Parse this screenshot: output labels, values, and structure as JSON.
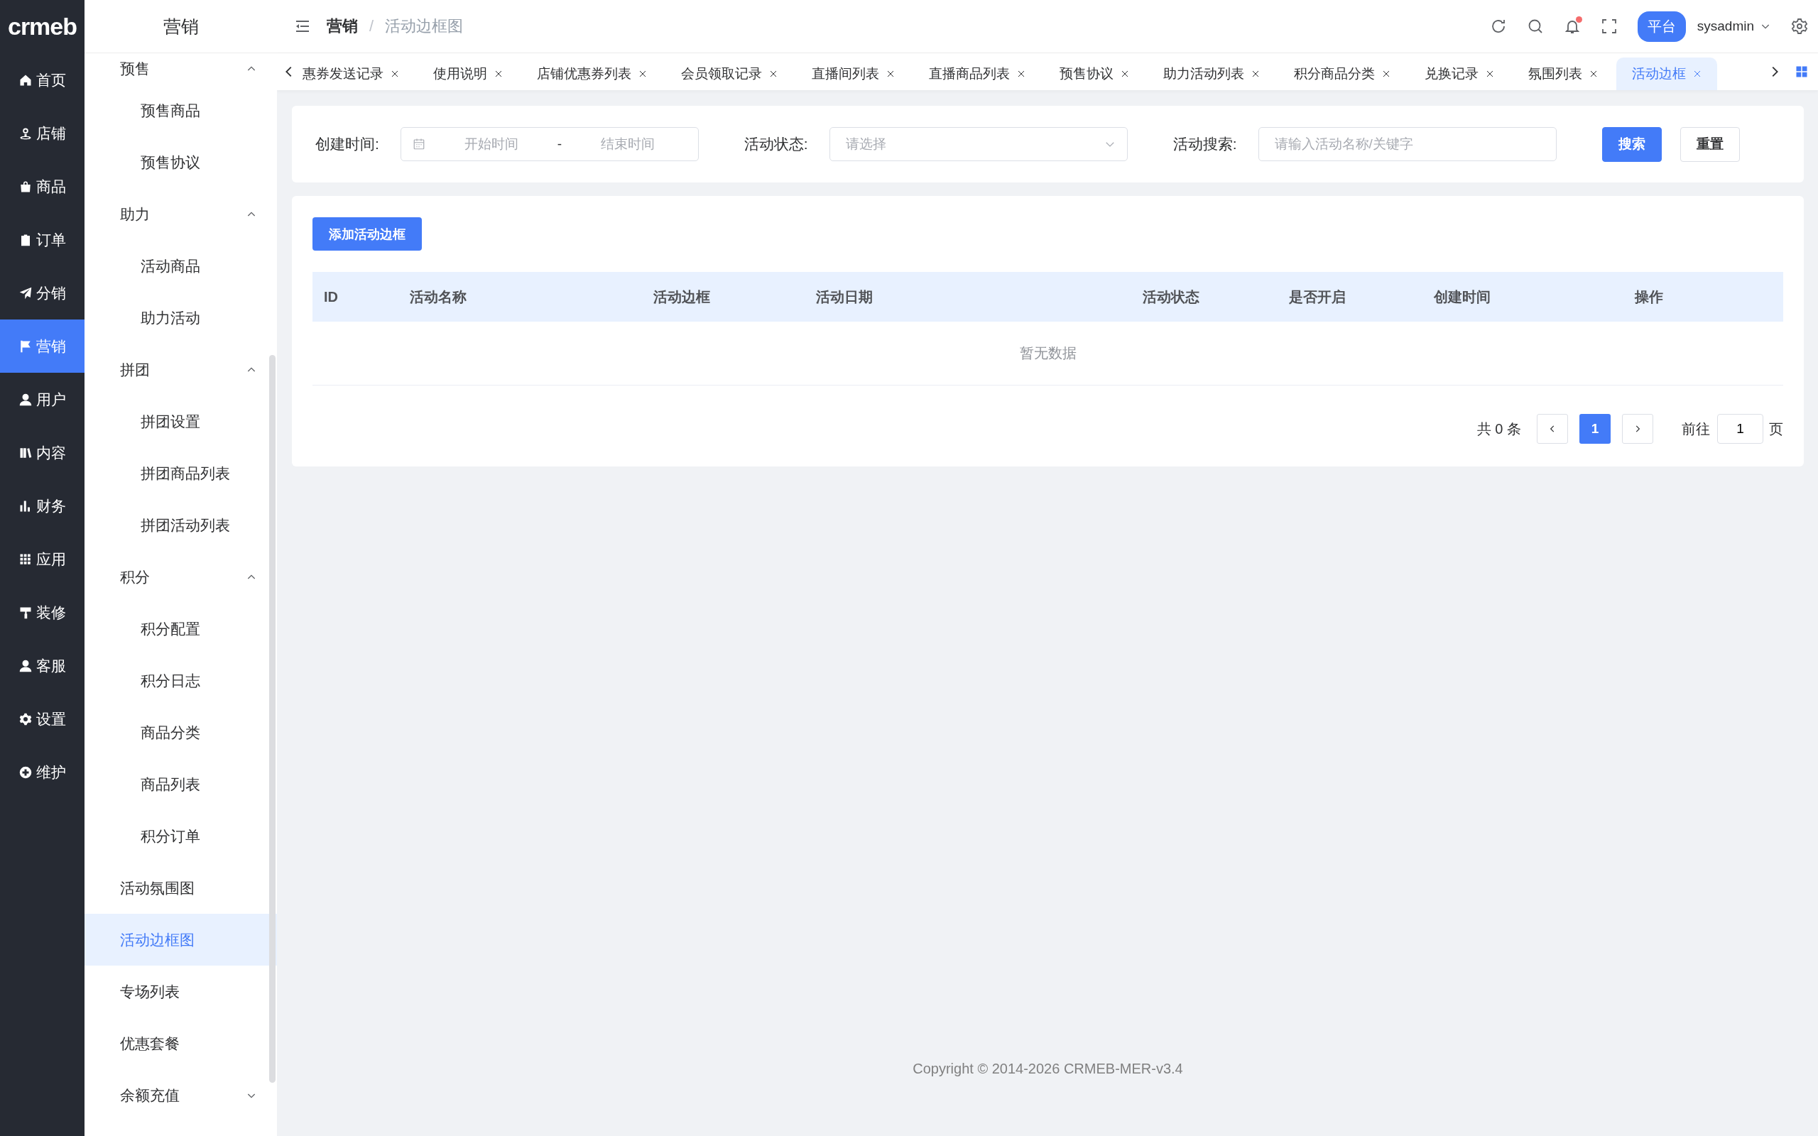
{
  "rail": {
    "logo": "crmeb",
    "items": [
      {
        "label": "首页",
        "selected": false
      },
      {
        "label": "店铺",
        "selected": false
      },
      {
        "label": "商品",
        "selected": false
      },
      {
        "label": "订单",
        "selected": false
      },
      {
        "label": "分销",
        "selected": false
      },
      {
        "label": "营销",
        "selected": true
      },
      {
        "label": "用户",
        "selected": false
      },
      {
        "label": "内容",
        "selected": false
      },
      {
        "label": "财务",
        "selected": false
      },
      {
        "label": "应用",
        "selected": false
      },
      {
        "label": "装修",
        "selected": false
      },
      {
        "label": "客服",
        "selected": false
      },
      {
        "label": "设置",
        "selected": false
      },
      {
        "label": "维护",
        "selected": false
      }
    ]
  },
  "sidebar": {
    "title": "营销",
    "items": [
      {
        "kind": "group",
        "label": "预售",
        "expanded": true,
        "children": [
          {
            "label": "预售商品",
            "selected": false
          },
          {
            "label": "预售协议",
            "selected": false
          }
        ]
      },
      {
        "kind": "group",
        "label": "助力",
        "expanded": true,
        "children": [
          {
            "label": "活动商品",
            "selected": false
          },
          {
            "label": "助力活动",
            "selected": false
          }
        ]
      },
      {
        "kind": "group",
        "label": "拼团",
        "expanded": true,
        "children": [
          {
            "label": "拼团设置",
            "selected": false
          },
          {
            "label": "拼团商品列表",
            "selected": false
          },
          {
            "label": "拼团活动列表",
            "selected": false
          }
        ]
      },
      {
        "kind": "group",
        "label": "积分",
        "expanded": true,
        "children": [
          {
            "label": "积分配置",
            "selected": false
          },
          {
            "label": "积分日志",
            "selected": false
          },
          {
            "label": "商品分类",
            "selected": false
          },
          {
            "label": "商品列表",
            "selected": false
          },
          {
            "label": "积分订单",
            "selected": false
          }
        ]
      },
      {
        "kind": "link",
        "label": "活动氛围图",
        "selected": false
      },
      {
        "kind": "link",
        "label": "活动边框图",
        "selected": true
      },
      {
        "kind": "link",
        "label": "专场列表",
        "selected": false
      },
      {
        "kind": "link",
        "label": "优惠套餐",
        "selected": false
      },
      {
        "kind": "group",
        "label": "余额充值",
        "expanded": false
      }
    ]
  },
  "header": {
    "breadcrumb": {
      "items": [
        "营销",
        "活动边框图"
      ],
      "separator": "/"
    },
    "platform_button": "平台",
    "user": "sysadmin",
    "notification_dot": true
  },
  "tabs": [
    {
      "label": "惠券发送记录",
      "selected": false
    },
    {
      "label": "使用说明",
      "selected": false
    },
    {
      "label": "店铺优惠券列表",
      "selected": false
    },
    {
      "label": "会员领取记录",
      "selected": false
    },
    {
      "label": "直播间列表",
      "selected": false
    },
    {
      "label": "直播商品列表",
      "selected": false
    },
    {
      "label": "预售协议",
      "selected": false
    },
    {
      "label": "助力活动列表",
      "selected": false
    },
    {
      "label": "积分商品分类",
      "selected": false
    },
    {
      "label": "兑换记录",
      "selected": false
    },
    {
      "label": "氛围列表",
      "selected": false
    },
    {
      "label": "活动边框",
      "selected": true
    }
  ],
  "filters": [
    {
      "kind": "daterange",
      "label": "创建时间:",
      "start_placeholder": "开始时间",
      "separator": "-",
      "end_placeholder": "结束时间"
    },
    {
      "kind": "select",
      "label": "活动状态:",
      "placeholder": "请选择"
    },
    {
      "kind": "text",
      "label": "活动搜索:",
      "placeholder": "请输入活动名称/关键字"
    }
  ],
  "filter_buttons": [
    {
      "kind": "primary",
      "label": "搜索"
    },
    {
      "kind": "default",
      "label": "重置"
    }
  ],
  "add_button": "添加活动边框",
  "table": {
    "columns": [
      "ID",
      "活动名称",
      "活动边框",
      "活动日期",
      "活动状态",
      "是否开启",
      "创建时间",
      "操作"
    ],
    "empty_text": "暂无数据"
  },
  "pagination": {
    "total": "共 0 条",
    "pages": [
      {
        "label": "1",
        "selected": true
      }
    ],
    "goto_label": "前往",
    "goto_value": "1",
    "page_suffix": "页"
  },
  "footer": "Copyright © 2014-2026 CRMEB-MER-v3.4"
}
